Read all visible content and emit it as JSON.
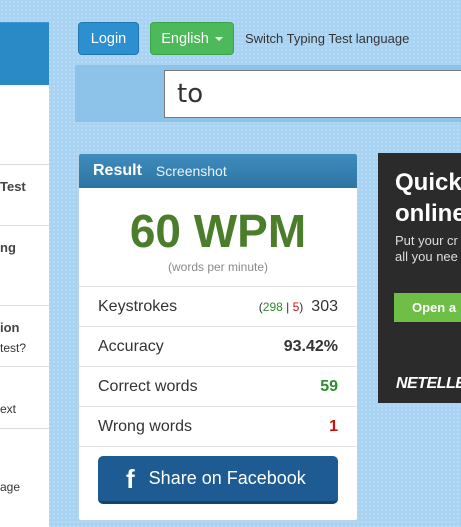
{
  "sidebar": {
    "items": [
      {
        "line1": "Test",
        "line2": ""
      },
      {
        "line1": "ng",
        "line2": ""
      },
      {
        "line1": "ion",
        "line2": "test?"
      },
      {
        "line1": "",
        "line2": "ext"
      },
      {
        "line1": "",
        "line2": "age"
      }
    ]
  },
  "toolbar": {
    "login_label": "Login",
    "language_label": "English",
    "language_hint": "Switch Typing Test language"
  },
  "typing": {
    "current_word": "to"
  },
  "result": {
    "title": "Result",
    "screenshot_label": "Screenshot",
    "wpm": "60 WPM",
    "wpm_caption": "(words per minute)",
    "keystrokes": {
      "label": "Keystrokes",
      "open_paren": "(",
      "correct": "298",
      "separator": "|",
      "wrong": "5",
      "close_paren": ")",
      "total": "303"
    },
    "accuracy": {
      "label": "Accuracy",
      "value": "93.42%"
    },
    "correct_words": {
      "label": "Correct words",
      "value": "59"
    },
    "wrong_words": {
      "label": "Wrong words",
      "value": "1"
    },
    "share_label": "Share on Facebook",
    "share_icon": "f"
  },
  "ad": {
    "headline_line1": "Quick",
    "headline_line2": "online",
    "body_line1": "Put your cr",
    "body_line2": "all you nee",
    "button": "Open a",
    "logo": "NETELLE"
  },
  "colors": {
    "login_button": "#2b8fd0",
    "language_button": "#4cb95b",
    "wpm_text": "#4b7d2a",
    "facebook_button": "#1f5b93",
    "ad_background": "#2b2b2b",
    "ad_button": "#6fbe45"
  }
}
